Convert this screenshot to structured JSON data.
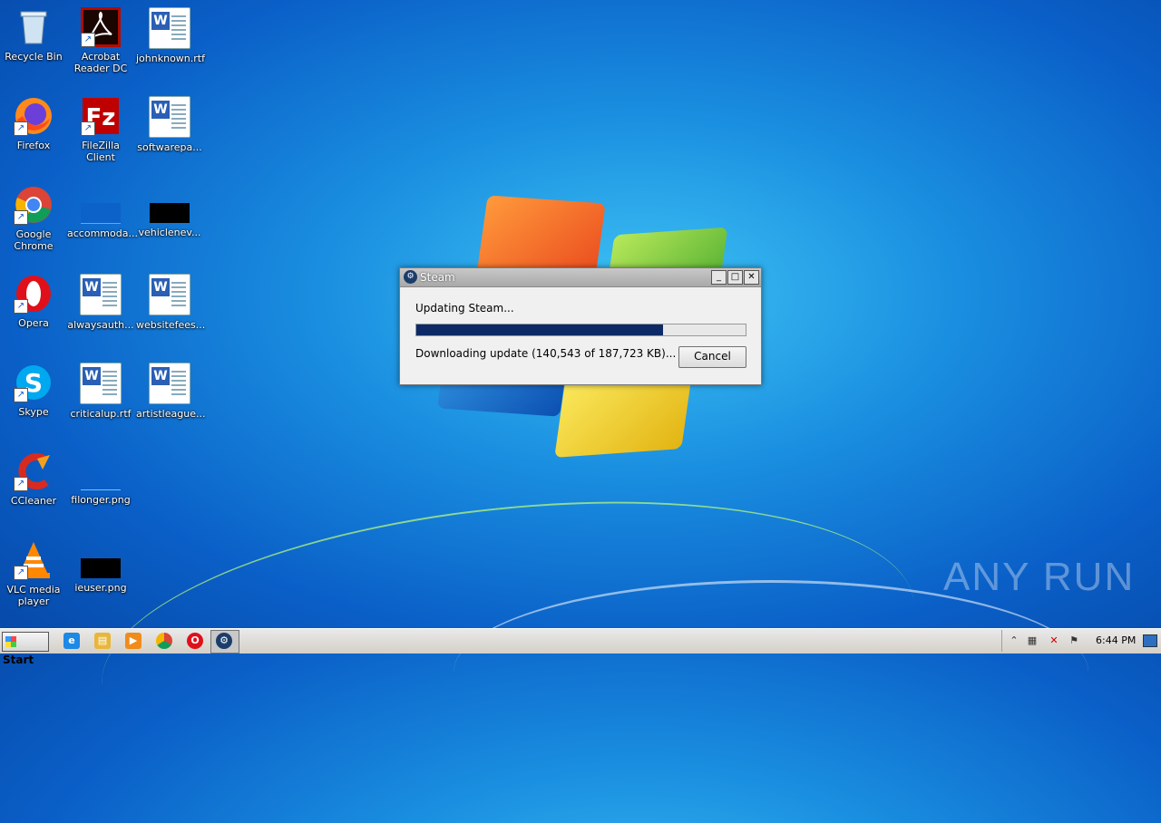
{
  "desktop": {
    "icons": [
      {
        "label": "Recycle Bin",
        "kind": "recycle-bin"
      },
      {
        "label": "Acrobat Reader DC",
        "kind": "acrobat"
      },
      {
        "label": "johnknown.rtf",
        "kind": "word-doc"
      },
      {
        "label": "Firefox",
        "kind": "firefox"
      },
      {
        "label": "FileZilla Client",
        "kind": "filezilla"
      },
      {
        "label": "softwarepa...",
        "kind": "word-doc"
      },
      {
        "label": "Google Chrome",
        "kind": "chrome"
      },
      {
        "label": "accommoda...",
        "kind": "image-blue"
      },
      {
        "label": "vehiclenev...",
        "kind": "image-black"
      },
      {
        "label": "Opera",
        "kind": "opera"
      },
      {
        "label": "alwaysauth...",
        "kind": "word-doc"
      },
      {
        "label": "websitefees...",
        "kind": "word-doc"
      },
      {
        "label": "Skype",
        "kind": "skype"
      },
      {
        "label": "criticalup.rtf",
        "kind": "word-doc"
      },
      {
        "label": "artistleague...",
        "kind": "word-doc"
      },
      {
        "label": "CCleaner",
        "kind": "ccleaner"
      },
      {
        "label": "filonger.png",
        "kind": "image-empty"
      },
      {
        "label": "VLC media player",
        "kind": "vlc"
      },
      {
        "label": "ieuser.png",
        "kind": "image-black"
      }
    ]
  },
  "dialog": {
    "title": "Steam",
    "status": "Updating Steam...",
    "progress_percent": 75,
    "detail": "Downloading update (140,543 of 187,723 KB)...",
    "cancel_label": "Cancel",
    "minimize_glyph": "_",
    "maximize_glyph": "□",
    "close_glyph": "✕"
  },
  "watermark": "ANY RUN",
  "taskbar": {
    "start_label": "Start",
    "clock": "6:44 PM",
    "pinned": [
      "ie-icon",
      "explorer-icon",
      "media-player-icon",
      "chrome-icon",
      "opera-icon",
      "steam-icon"
    ]
  },
  "colors": {
    "progress_fill": "#0d2a66",
    "desktop_blue": "#0a5fc7"
  }
}
